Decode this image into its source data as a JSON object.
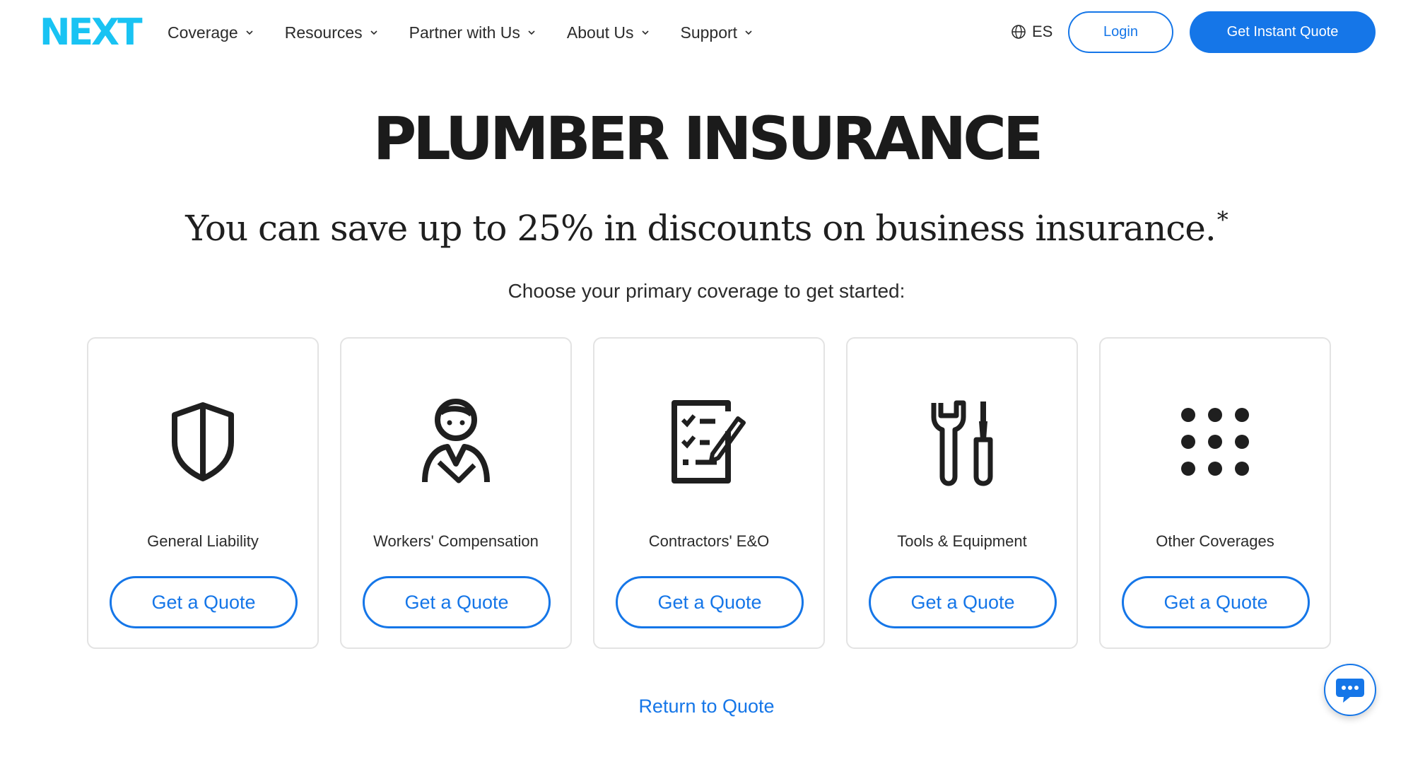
{
  "header": {
    "logo_text": "NEXT",
    "nav": [
      {
        "label": "Coverage"
      },
      {
        "label": "Resources"
      },
      {
        "label": "Partner with Us"
      },
      {
        "label": "About Us"
      },
      {
        "label": "Support"
      }
    ],
    "language": "ES",
    "login_label": "Login",
    "cta_label": "Get Instant Quote"
  },
  "hero": {
    "title": "PLUMBER INSURANCE",
    "subtitle": "You can save up to 25% in discounts on business insurance.",
    "subtitle_mark": "*",
    "prompt": "Choose your primary coverage to get started:"
  },
  "cards": [
    {
      "icon": "shield-icon",
      "label": "General Liability",
      "button": "Get a Quote"
    },
    {
      "icon": "worker-icon",
      "label": "Workers' Compensation",
      "button": "Get a Quote"
    },
    {
      "icon": "checklist-icon",
      "label": "Contractors' E&O",
      "button": "Get a Quote"
    },
    {
      "icon": "tools-icon",
      "label": "Tools & Equipment",
      "button": "Get a Quote"
    },
    {
      "icon": "grid-dots-icon",
      "label": "Other Coverages",
      "button": "Get a Quote"
    }
  ],
  "return_link": "Return to Quote",
  "colors": {
    "brand_cyan": "#19c3f3",
    "accent_blue": "#1576e8",
    "text_dark": "#1b1b1b"
  }
}
